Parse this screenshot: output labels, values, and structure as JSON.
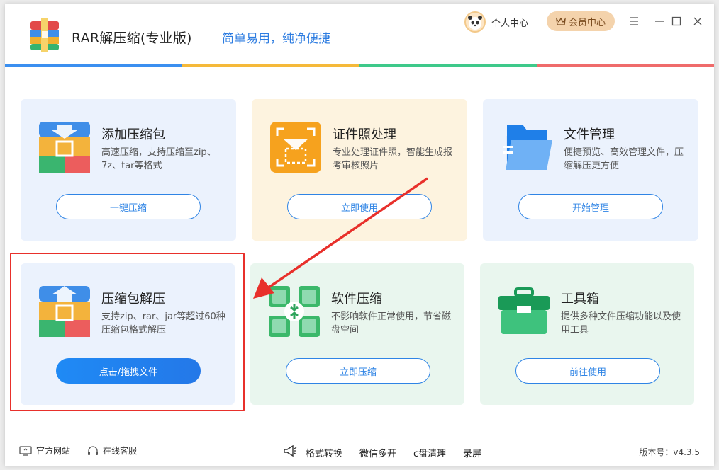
{
  "header": {
    "app_title": "RAR解压缩(专业版)",
    "slogan": "简单易用，纯净便捷",
    "user_center": "个人中心",
    "vip_center": "会员中心"
  },
  "colors": {
    "accent_blue": "#2f84e5",
    "bar": [
      "#3b8ff0",
      "#f5b93a",
      "#3ec98a",
      "#ef6b6b"
    ],
    "highlight_red": "#e8302b"
  },
  "cards": [
    {
      "title": "添加压缩包",
      "desc": "高速压缩，支持压缩至zip、7z、tar等格式",
      "button": "一键压缩",
      "icon": "compress-package-icon"
    },
    {
      "title": "证件照处理",
      "desc": "专业处理证件照，智能生成报考审核照片",
      "button": "立即使用",
      "icon": "id-photo-icon"
    },
    {
      "title": "文件管理",
      "desc": "便捷预览、高效管理文件，压缩解压更方便",
      "button": "开始管理",
      "icon": "folder-icon"
    },
    {
      "title": "压缩包解压",
      "desc": "支持zip、rar、jar等超过60种压缩包格式解压",
      "button": "点击/拖拽文件",
      "icon": "extract-package-icon"
    },
    {
      "title": "软件压缩",
      "desc": "不影响软件正常使用，节省磁盘空间",
      "button": "立即压缩",
      "icon": "software-compress-icon"
    },
    {
      "title": "工具箱",
      "desc": "提供多种文件压缩功能以及使用工具",
      "button": "前往使用",
      "icon": "toolbox-icon"
    }
  ],
  "footer": {
    "website": "官方网站",
    "support": "在线客服",
    "format_convert": "格式转换",
    "wechat_multi": "微信多开",
    "c_clean": "c盘清理",
    "record": "录屏",
    "version": "版本号：v4.3.5"
  }
}
